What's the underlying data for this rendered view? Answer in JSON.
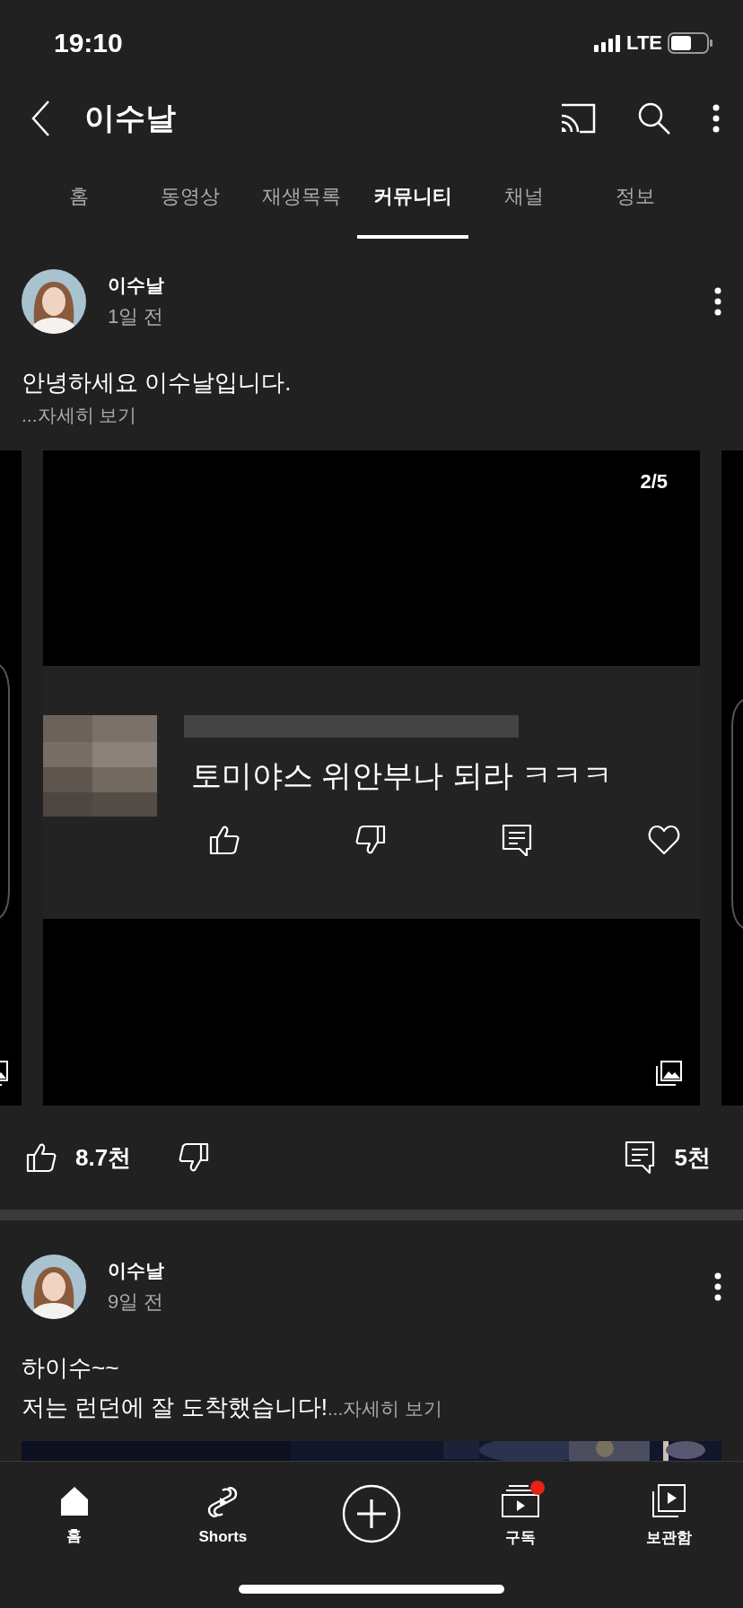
{
  "status_bar": {
    "time": "19:10",
    "network": "LTE"
  },
  "header": {
    "title": "이수날"
  },
  "tabs": [
    {
      "label": "홈",
      "selected": false
    },
    {
      "label": "동영상",
      "selected": false
    },
    {
      "label": "재생목록",
      "selected": false
    },
    {
      "label": "커뮤니티",
      "selected": true
    },
    {
      "label": "채널",
      "selected": false
    },
    {
      "label": "정보",
      "selected": false
    }
  ],
  "posts": [
    {
      "author": "이수날",
      "time": "1일 전",
      "lines": [
        {
          "text": "안녕하세요 이수날입니다."
        },
        {
          "more": "...자세히 보기"
        }
      ],
      "media": {
        "kind": "carousel",
        "counter": "2/5",
        "comment": "토미야스 위안부나 되라 ㅋㅋㅋ"
      },
      "likes": "8.7천",
      "comments": "5천"
    },
    {
      "author": "이수날",
      "time": "9일 전",
      "lines": [
        {
          "text": "하이수~~"
        },
        {
          "text": "저는 런던에 잘 도착했습니다!",
          "more": "...자세히 보기"
        }
      ]
    }
  ],
  "bottom_nav": [
    {
      "kind": "home",
      "label": "홈",
      "dot": false
    },
    {
      "kind": "shorts",
      "label": "Shorts",
      "dot": false
    },
    {
      "kind": "create",
      "dot": false
    },
    {
      "kind": "subscriptions",
      "label": "구독",
      "dot": true
    },
    {
      "kind": "library",
      "label": "보관함",
      "dot": false
    }
  ]
}
